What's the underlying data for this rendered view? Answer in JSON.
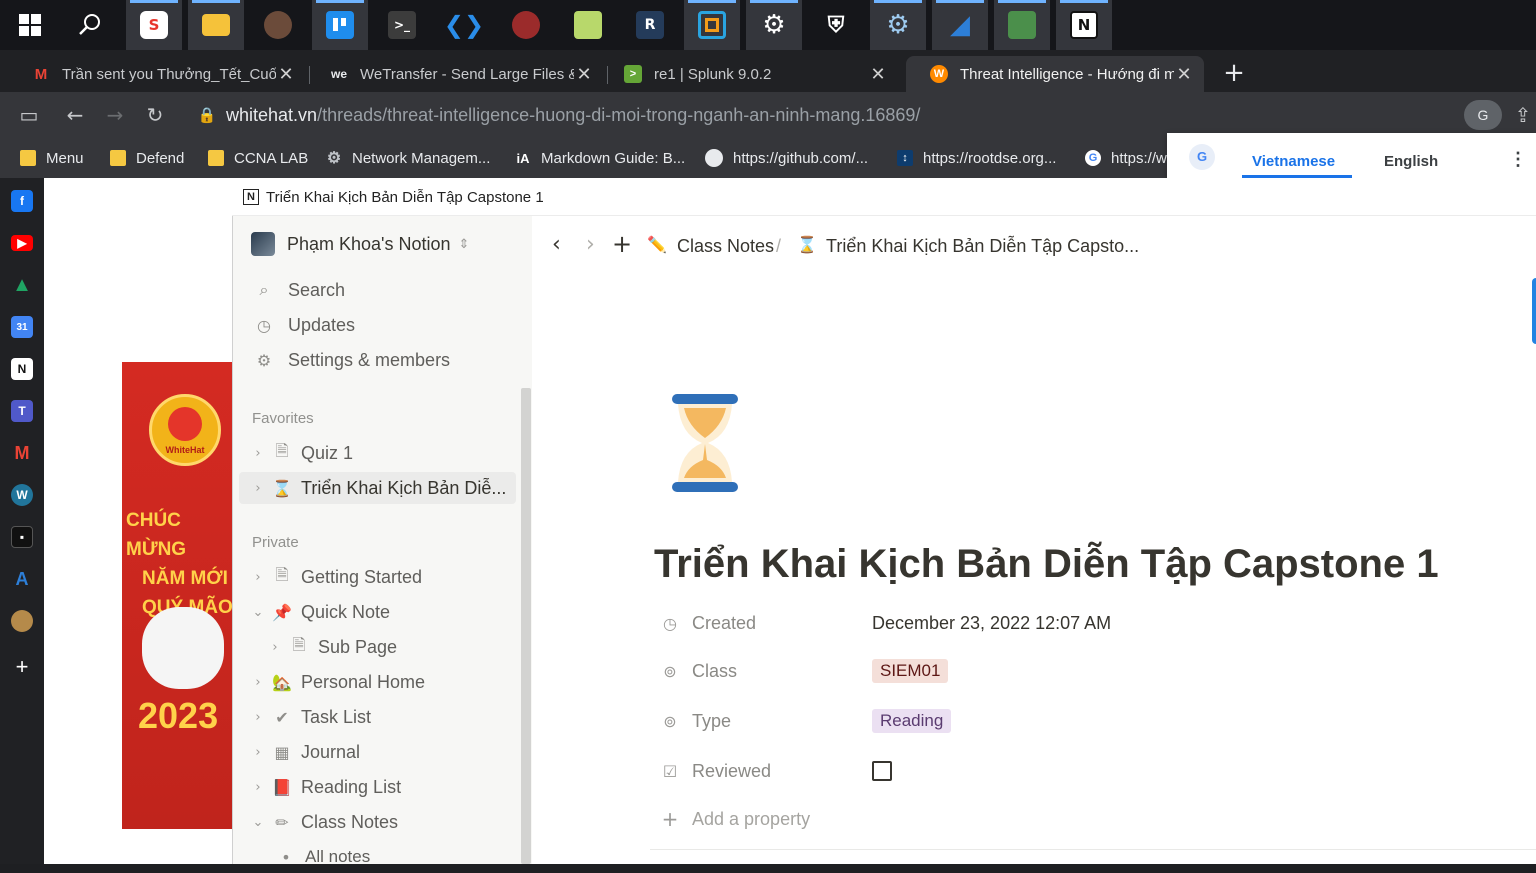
{
  "taskbar": {
    "icons": [
      "windows-start-icon",
      "search-icon",
      "app-s-icon",
      "file-explorer-icon",
      "portrait-icon",
      "trello-icon",
      "terminal-icon",
      "vscode-icon",
      "avatar-red-icon",
      "notepad-icon",
      "rstudio-icon",
      "orange-stack-icon",
      "settings-gear-icon",
      "shield-icon",
      "network-gear-icon",
      "wireshark-icon",
      "remote-desktop-icon",
      "notion-icon"
    ]
  },
  "tabs": [
    {
      "title": "Trần sent you Thưởng_Tết_Cuối_N",
      "fav": "M",
      "color": "#ea4335"
    },
    {
      "title": "WeTransfer - Send Large Files & S",
      "fav": "we",
      "color": "#202124"
    },
    {
      "title": "re1 | Splunk 9.0.2",
      "fav": ">",
      "color": "#65a637"
    },
    {
      "title": "Threat Intelligence - Hướng đi mới",
      "fav": "W",
      "color": "#ff8a00"
    }
  ],
  "address": {
    "host": "whitehat.vn",
    "path": "/threads/threat-intelligence-huong-di-moi-trong-nganh-an-ninh-mang.16869/"
  },
  "bookmarks": [
    {
      "label": "Menu",
      "type": "folder"
    },
    {
      "label": "Defend",
      "type": "folder"
    },
    {
      "label": "CCNA LAB",
      "type": "folder"
    },
    {
      "label": "Network Managem...",
      "type": "gear"
    },
    {
      "label": "Markdown Guide: B...",
      "type": "ia"
    },
    {
      "label": "https://github.com/...",
      "type": "github"
    },
    {
      "label": "https://rootdse.org...",
      "type": "rootdse"
    },
    {
      "label": "https://w",
      "type": "google"
    }
  ],
  "translate": {
    "lang_from": "Vietnamese",
    "lang_to": "English"
  },
  "banner": {
    "line1": "CHÚC MỪNG",
    "line2": "NĂM MỚI",
    "line3": "QUÝ MÃO",
    "year": "2023",
    "logo": "WhiteHat"
  },
  "notion": {
    "window_title": "Triển Khai Kịch Bản Diễn Tập Capstone 1",
    "workspace": "Phạm Khoa's Notion",
    "nav": [
      {
        "label": "Search",
        "icon": "⌕"
      },
      {
        "label": "Updates",
        "icon": "◷"
      },
      {
        "label": "Settings & members",
        "icon": "⚙"
      }
    ],
    "favorites_label": "Favorites",
    "favorites": [
      {
        "label": "Quiz 1",
        "icon": "🗎"
      },
      {
        "label": "Triển Khai Kịch Bản Diễ...",
        "icon": "⌛"
      }
    ],
    "private_label": "Private",
    "private": [
      {
        "label": "Getting Started",
        "icon": "🗎",
        "chev": "›",
        "indent": 0
      },
      {
        "label": "Quick Note",
        "icon": "📌",
        "chev": "⌄",
        "indent": 0
      },
      {
        "label": "Sub Page",
        "icon": "🗎",
        "chev": "›",
        "indent": 1
      },
      {
        "label": "Personal Home",
        "icon": "🏡",
        "chev": "›",
        "indent": 0
      },
      {
        "label": "Task List",
        "icon": "✔",
        "chev": "›",
        "indent": 0
      },
      {
        "label": "Journal",
        "icon": "▦",
        "chev": "›",
        "indent": 0
      },
      {
        "label": "Reading List",
        "icon": "📕",
        "chev": "›",
        "indent": 0
      },
      {
        "label": "Class Notes",
        "icon": "✏",
        "chev": "⌄",
        "indent": 0
      },
      {
        "label": "All notes",
        "icon": "•",
        "chev": "",
        "indent": 0
      }
    ],
    "breadcrumb": [
      "Class Notes",
      "Triển Khai Kịch Bản Diễn Tập Capsto..."
    ],
    "page_title": "Triển Khai Kịch Bản Diễn Tập Capstone 1",
    "properties": {
      "created_label": "Created",
      "created_value": "December 23, 2022 12:07 AM",
      "class_label": "Class",
      "class_value": "SIEM01",
      "type_label": "Type",
      "type_value": "Reading",
      "reviewed_label": "Reviewed",
      "add_property": "Add a property"
    }
  }
}
